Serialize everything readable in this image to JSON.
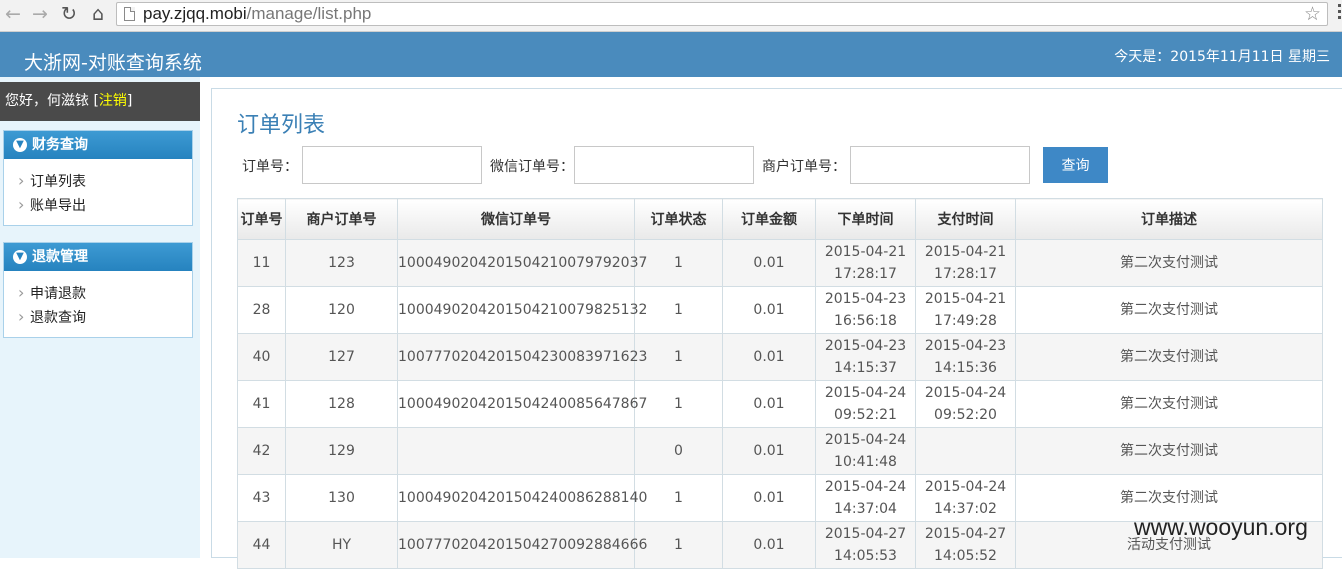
{
  "browser": {
    "url_host": "pay.zjqq.mobi",
    "url_path": "/manage/list.php",
    "icons": [
      "back-icon",
      "forward-icon",
      "reload-icon",
      "home-icon",
      "page-icon",
      "star-icon",
      "menu-icon"
    ]
  },
  "header": {
    "title": "大浙网-对账查询系统",
    "today": "今天是：2015年11月11日 星期三",
    "bg_color": "#4a8bbd"
  },
  "sidebar": {
    "greeting_prefix": "您好，何滋铱 [",
    "logout_label": "注销",
    "greeting_suffix": "]",
    "sections": [
      {
        "title": "财务查询",
        "items": [
          {
            "label": "订单列表"
          },
          {
            "label": "账单导出"
          }
        ]
      },
      {
        "title": "退款管理",
        "items": [
          {
            "label": "申请退款"
          },
          {
            "label": "退款查询"
          }
        ]
      }
    ]
  },
  "main": {
    "title": "订单列表",
    "filters": {
      "order_no_label": "订单号：",
      "wechat_order_label": "微信订单号：",
      "merchant_order_label": "商户订单号：",
      "order_no_value": "",
      "wechat_order_value": "",
      "merchant_order_value": "",
      "query_button": "查询"
    },
    "table": {
      "columns": [
        "订单号",
        "商户订单号",
        "微信订单号",
        "订单状态",
        "订单金额",
        "下单时间",
        "支付时间",
        "订单描述"
      ],
      "rows": [
        [
          "11",
          "123",
          "100049020420150421007979 2037",
          "1",
          "0.01",
          "2015-04-21|17:28:17",
          "2015-04-21|17:28:17",
          "第二次支付测试"
        ],
        [
          "28",
          "120",
          "1000490204201504210079825132",
          "1",
          "0.01",
          "2015-04-23|16:56:18",
          "2015-04-21|17:49:28",
          "第二次支付测试"
        ],
        [
          "40",
          "127",
          "1007770204201504230083971623",
          "1",
          "0.01",
          "2015-04-23|14:15:37",
          "2015-04-23|14:15:36",
          "第二次支付测试"
        ],
        [
          "41",
          "128",
          "1000490204201504240085647867",
          "1",
          "0.01",
          "2015-04-24|09:52:21",
          "2015-04-24|09:52:20",
          "第二次支付测试"
        ],
        [
          "42",
          "129",
          "",
          "0",
          "0.01",
          "2015-04-24|10:41:48",
          "",
          "第二次支付测试"
        ],
        [
          "43",
          "130",
          "1000490204201504240086288140",
          "1",
          "0.01",
          "2015-04-24|14:37:04",
          "2015-04-24|14:37:02",
          "第二次支付测试"
        ],
        [
          "44",
          "HY",
          "1007770204201504270092884666",
          "1",
          "0.01",
          "2015-04-27|14:05:53",
          "2015-04-27|14:05:52",
          "活动支付测试"
        ]
      ]
    }
  },
  "watermark": "www.wooyun.org"
}
